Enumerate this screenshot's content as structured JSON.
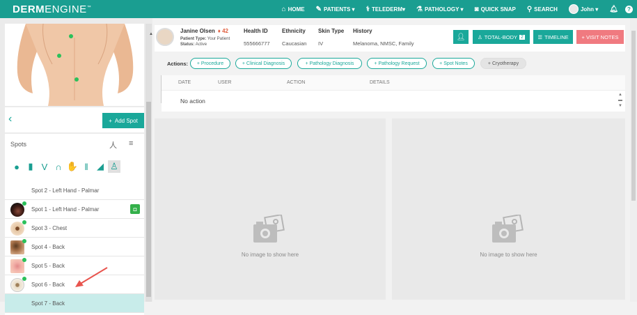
{
  "app": {
    "logo_bold": "DERM",
    "logo_thin": "ENGINE",
    "trademark": "™"
  },
  "nav": {
    "home": "HOME",
    "patients": "PATIENTS ▾",
    "telederm": "TELEDERM▾",
    "pathology": "PATHOLOGY ▾",
    "quick_snap": "QUICK SNAP",
    "search": "SEARCH",
    "user": "John ▾"
  },
  "left": {
    "add_spot": "Add Spot",
    "spots_title": "Spots",
    "spots": [
      {
        "label": "Spot 2 - Left Hand - Palmar",
        "thumb": "none"
      },
      {
        "label": "Spot 1 - Left Hand - Palmar",
        "thumb": "dark",
        "badge": true
      },
      {
        "label": "Spot 3 - Chest",
        "thumb": "mole"
      },
      {
        "label": "Spot 4 - Back",
        "thumb": "brown"
      },
      {
        "label": "Spot 5 - Back",
        "thumb": "pink"
      },
      {
        "label": "Spot 6 - Back",
        "thumb": "mole"
      },
      {
        "label": "Spot 7 - Back",
        "thumb": "none",
        "active": true
      }
    ]
  },
  "patient": {
    "name": "Janine Olsen",
    "age": "42",
    "type_label": "Patient Type:",
    "type_value": "Your Patient",
    "status_label": "Status:",
    "status_value": "Active",
    "health_id_label": "Health ID",
    "health_id": "555666777",
    "ethnicity_label": "Ethnicity",
    "ethnicity": "Caucasian",
    "skin_type_label": "Skin Type",
    "skin_type": "IV",
    "history_label": "History",
    "history": "Melanoma, NMSC, Family"
  },
  "buttons": {
    "total_body": "TOTAL-BODY",
    "total_body_count": "2",
    "timeline": "TIMELINE",
    "visit_notes": "+ VISIT NOTES"
  },
  "actions": {
    "label": "Actions:",
    "items": [
      "+ Procedure",
      "+ Clinical Diagnosis",
      "+ Pathology Diagnosis",
      "+ Pathology Request",
      "+ Spot Notes",
      "+ Cryotherapy"
    ]
  },
  "table": {
    "headers": [
      "DATE",
      "USER",
      "ACTION",
      "DETAILS"
    ],
    "empty": "No action"
  },
  "images": {
    "empty_left": "No image to show here",
    "empty_right": "No image to show here"
  },
  "colors": {
    "teal": "#1a9e91",
    "pink": "#f07a80",
    "active_row": "#c8ecea"
  }
}
